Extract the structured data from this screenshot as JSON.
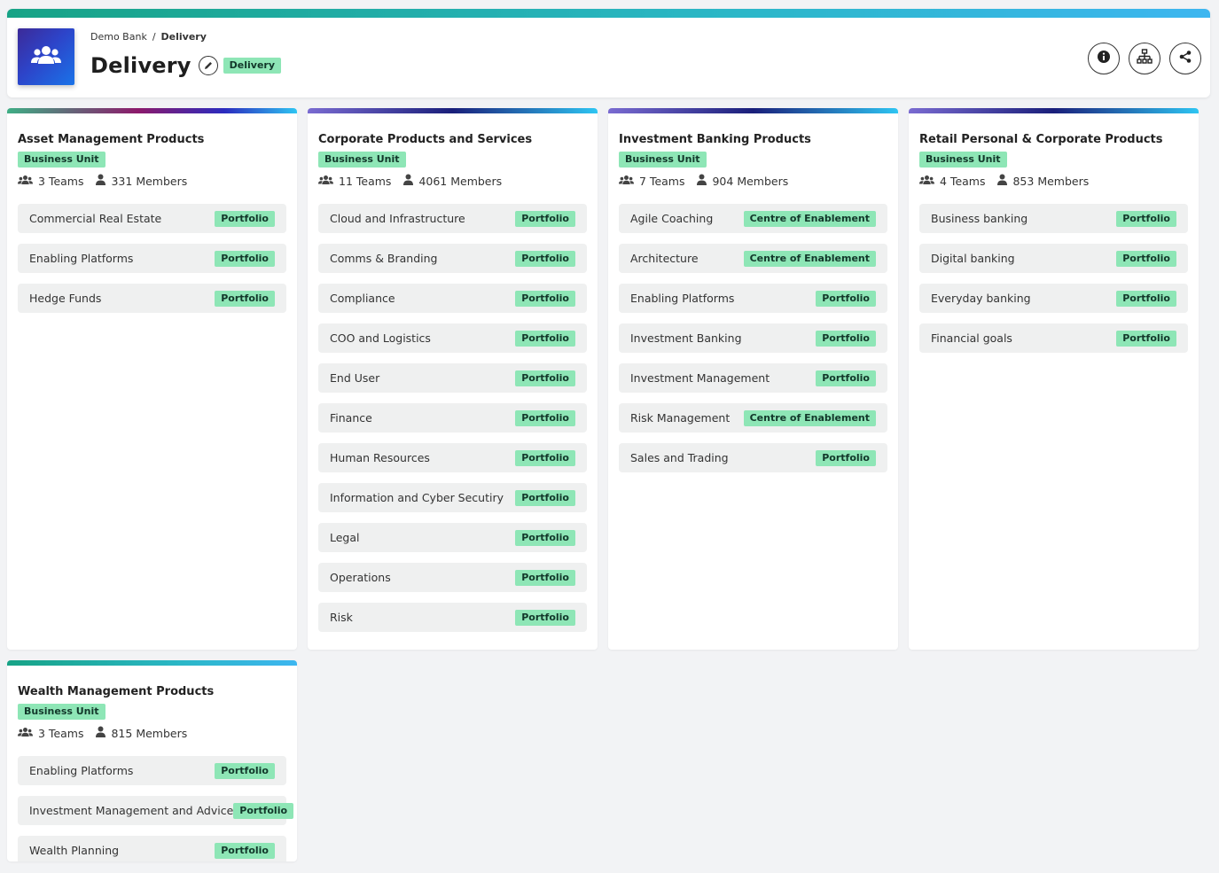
{
  "header": {
    "breadcrumb": [
      "Demo Bank",
      "Delivery"
    ],
    "title": "Delivery",
    "badge": "Delivery",
    "actions": [
      "info-icon",
      "hierarchy-icon",
      "share-icon"
    ]
  },
  "colors": {
    "badge": "#8ee6b6",
    "badge_text": "#12372a",
    "item_bg": "#eff0f0"
  },
  "cards": [
    {
      "name": "Asset Management Products",
      "badge": "Business Unit",
      "teams": "3 Teams",
      "members": "331 Members",
      "items": [
        {
          "label": "Commercial Real Estate",
          "tag": "Portfolio"
        },
        {
          "label": "Enabling Platforms",
          "tag": "Portfolio"
        },
        {
          "label": "Hedge Funds",
          "tag": "Portfolio"
        }
      ]
    },
    {
      "name": "Corporate Products and Services",
      "badge": "Business Unit",
      "teams": "11 Teams",
      "members": "4061 Members",
      "items": [
        {
          "label": "Cloud and Infrastructure",
          "tag": "Portfolio"
        },
        {
          "label": "Comms & Branding",
          "tag": "Portfolio"
        },
        {
          "label": "Compliance",
          "tag": "Portfolio"
        },
        {
          "label": "COO and Logistics",
          "tag": "Portfolio"
        },
        {
          "label": "End User",
          "tag": "Portfolio"
        },
        {
          "label": "Finance",
          "tag": "Portfolio"
        },
        {
          "label": "Human Resources",
          "tag": "Portfolio"
        },
        {
          "label": "Information and Cyber Secutiry",
          "tag": "Portfolio"
        },
        {
          "label": "Legal",
          "tag": "Portfolio"
        },
        {
          "label": "Operations",
          "tag": "Portfolio"
        },
        {
          "label": "Risk",
          "tag": "Portfolio"
        }
      ]
    },
    {
      "name": "Investment Banking Products",
      "badge": "Business Unit",
      "teams": "7 Teams",
      "members": "904 Members",
      "items": [
        {
          "label": "Agile Coaching",
          "tag": "Centre of Enablement"
        },
        {
          "label": "Architecture",
          "tag": "Centre of Enablement"
        },
        {
          "label": "Enabling Platforms",
          "tag": "Portfolio"
        },
        {
          "label": "Investment Banking",
          "tag": "Portfolio"
        },
        {
          "label": "Investment Management",
          "tag": "Portfolio"
        },
        {
          "label": "Risk Management",
          "tag": "Centre of Enablement"
        },
        {
          "label": "Sales and Trading",
          "tag": "Portfolio"
        }
      ]
    },
    {
      "name": "Retail Personal & Corporate Products",
      "badge": "Business Unit",
      "teams": "4 Teams",
      "members": "853 Members",
      "items": [
        {
          "label": "Business banking",
          "tag": "Portfolio"
        },
        {
          "label": "Digital banking",
          "tag": "Portfolio"
        },
        {
          "label": "Everyday banking",
          "tag": "Portfolio"
        },
        {
          "label": "Financial goals",
          "tag": "Portfolio"
        }
      ]
    },
    {
      "name": "Wealth Management Products",
      "badge": "Business Unit",
      "teams": "3 Teams",
      "members": "815 Members",
      "items": [
        {
          "label": "Enabling Platforms",
          "tag": "Portfolio"
        },
        {
          "label": "Investment Management and Advice",
          "tag": "Portfolio"
        },
        {
          "label": "Wealth Planning",
          "tag": "Portfolio"
        }
      ]
    }
  ]
}
